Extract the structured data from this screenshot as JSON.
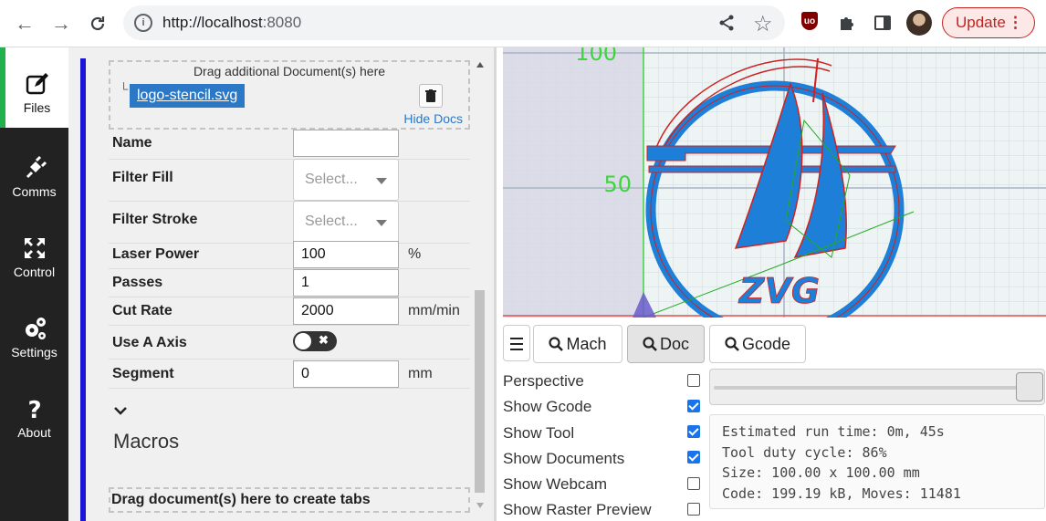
{
  "browser": {
    "url_host": "http://localhost",
    "url_port": ":8080",
    "update_label": "Update",
    "ublock_label": "uo"
  },
  "nav": {
    "items": [
      {
        "label": "Files",
        "icon": "pencil-square-icon",
        "active": true
      },
      {
        "label": "Comms",
        "icon": "plug-icon",
        "active": false
      },
      {
        "label": "Control",
        "icon": "arrows-icon",
        "active": false
      },
      {
        "label": "Settings",
        "icon": "gears-icon",
        "active": false
      },
      {
        "label": "About",
        "icon": "question-icon",
        "active": false
      }
    ]
  },
  "files": {
    "drop_title": "Drag additional Document(s) here",
    "doc_name": "logo-stencil.svg",
    "hide_docs": "Hide Docs",
    "fields": {
      "name_label": "Name",
      "name_value": "",
      "filter_fill_label": "Filter Fill",
      "filter_fill_placeholder": "Select...",
      "filter_stroke_label": "Filter Stroke",
      "filter_stroke_placeholder": "Select...",
      "laser_power_label": "Laser Power",
      "laser_power_value": "100",
      "laser_power_unit": "%",
      "passes_label": "Passes",
      "passes_value": "1",
      "cut_rate_label": "Cut Rate",
      "cut_rate_value": "2000",
      "cut_rate_unit": "mm/min",
      "use_a_axis_label": "Use A Axis",
      "use_a_axis_on": false,
      "segment_label": "Segment",
      "segment_value": "0",
      "segment_unit": "mm"
    },
    "macros_label": "Macros",
    "tabs_drop_label": "Drag document(s) here to create tabs"
  },
  "canvas": {
    "y_labels": [
      "100",
      "50"
    ],
    "logo_text": "ZVG"
  },
  "view": {
    "buttons": [
      {
        "label": "Mach",
        "active": false
      },
      {
        "label": "Doc",
        "active": true
      },
      {
        "label": "Gcode",
        "active": false
      }
    ],
    "options": [
      {
        "label": "Perspective",
        "checked": false
      },
      {
        "label": "Show Gcode",
        "checked": true
      },
      {
        "label": "Show Tool",
        "checked": true
      },
      {
        "label": "Show Documents",
        "checked": true
      },
      {
        "label": "Show Webcam",
        "checked": false
      },
      {
        "label": "Show Raster Preview",
        "checked": false
      }
    ],
    "zoom_slider_value": 1.0,
    "stats": [
      "Estimated run time: 0m, 45s",
      "Tool duty cycle: 86%",
      "Size: 100.00 x 100.00 mm",
      "Code: 199.19 kB, Moves: 11481"
    ]
  }
}
